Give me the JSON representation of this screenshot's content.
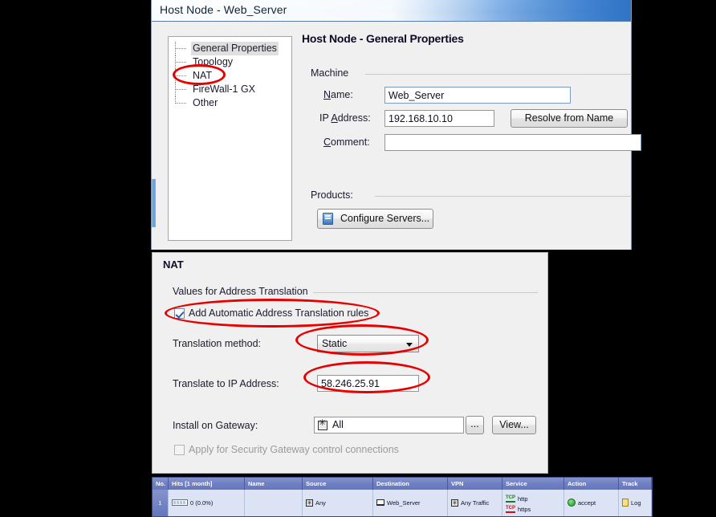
{
  "window": {
    "title": "Host Node - Web_Server"
  },
  "sidebar": {
    "items": [
      {
        "label": "General Properties",
        "selected": true
      },
      {
        "label": "Topology",
        "selected": false
      },
      {
        "label": "NAT",
        "selected": false
      },
      {
        "label": "FireWall-1 GX",
        "selected": false
      },
      {
        "label": "Other",
        "selected": false
      }
    ]
  },
  "general": {
    "pane_title": "Host Node - General Properties",
    "machine_group": "Machine",
    "name_label": "Name:",
    "name_value": "Web_Server",
    "ip_label": "IP Address:",
    "ip_value": "192.168.10.10",
    "resolve_button": "Resolve from Name",
    "comment_label": "Comment:",
    "comment_value": "",
    "comment_placeholder": "",
    "products_group": "Products:",
    "configure_button": "Configure Servers..."
  },
  "nat": {
    "title": "NAT",
    "group_label": "Values for Address Translation",
    "auto_rules_label": "Add Automatic Address Translation rules",
    "auto_rules_checked": true,
    "method_label": "Translation method:",
    "method_value": "Static",
    "translate_label": "Translate to IP Address:",
    "translate_value": "58.246.25.91",
    "install_label": "Install on Gateway:",
    "install_value": "All",
    "browse_button": "...",
    "view_button": "View...",
    "apply_control_label": "Apply for Security Gateway control connections",
    "apply_control_checked": false
  },
  "rule_table": {
    "columns": [
      "No.",
      "Hits [1 month]",
      "Name",
      "Source",
      "Destination",
      "VPN",
      "Service",
      "Action",
      "Track"
    ],
    "rows": [
      {
        "no": "1",
        "hits": "0 (0.0%)",
        "name": "",
        "source": "Any",
        "destination": "Web_Server",
        "vpn": "Any Traffic",
        "service": [
          "http",
          "https"
        ],
        "action": "accept",
        "track": "Log"
      }
    ]
  },
  "colors": {
    "annotation": "#e60000",
    "table_header": "#6f7fc3",
    "table_row": "#dbe3f4",
    "dialog_bg": "#f0f0f0"
  }
}
